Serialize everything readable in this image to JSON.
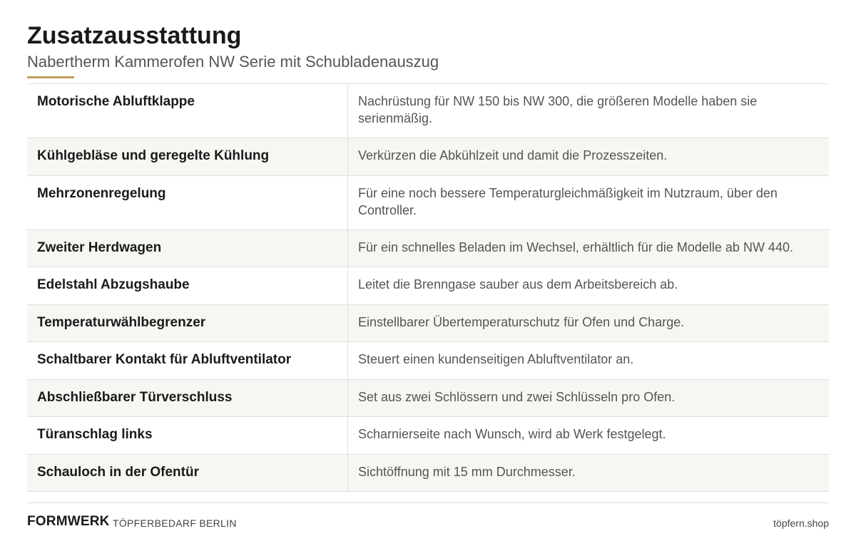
{
  "header": {
    "title": "Zusatzausstattung",
    "subtitle": "Nabertherm Kammerofen NW Serie mit Schubladenauszug"
  },
  "colors": {
    "accent": "#c0a060",
    "row_alt": "#f7f6f2",
    "divider": "#e0dfdc"
  },
  "rows": [
    {
      "name": "Motorische Abluftklappe",
      "description": "Nachrüstung für NW 150 bis NW 300, die größeren Modelle haben sie serienmäßig."
    },
    {
      "name": "Kühlgebläse und geregelte Kühlung",
      "description": "Verkürzen die Abkühlzeit und damit die Prozesszeiten."
    },
    {
      "name": "Mehrzonenregelung",
      "description": "Für eine noch bessere Temperaturgleichmäßigkeit im Nutzraum, über den Controller."
    },
    {
      "name": "Zweiter Herdwagen",
      "description": "Für ein schnelles Beladen im Wechsel, erhältlich für die Modelle ab NW 440."
    },
    {
      "name": "Edelstahl Abzugshaube",
      "description": "Leitet die Brenngase sauber aus dem Arbeitsbereich ab."
    },
    {
      "name": "Temperaturwählbegrenzer",
      "description": "Einstellbarer Übertemperaturschutz für Ofen und Charge."
    },
    {
      "name": "Schaltbarer Kontakt für Abluftventilator",
      "description": "Steuert einen kundenseitigen Abluftventilator an."
    },
    {
      "name": "Abschließbarer Türverschluss",
      "description": "Set aus zwei Schlössern und zwei Schlüsseln pro Ofen."
    },
    {
      "name": "Türanschlag links",
      "description": "Scharnierseite nach Wunsch, wird ab Werk festgelegt."
    },
    {
      "name": "Schauloch in der Ofentür",
      "description": "Sichtöffnung mit 15 mm Durchmesser."
    }
  ],
  "footer": {
    "brand": "FORMWERK",
    "brand_sub": "TÖPFERBEDARF BERLIN",
    "site": "töpfern.shop"
  }
}
